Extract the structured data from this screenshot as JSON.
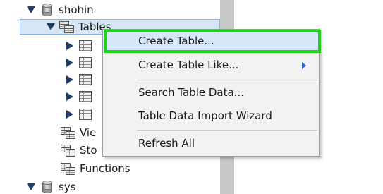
{
  "tree": {
    "schemas": [
      {
        "name": "shohin",
        "expanded": true
      },
      {
        "name": "sys",
        "expanded": true
      }
    ],
    "tables_label": "Tables",
    "views_label": "Vie",
    "stored_label": "Sto",
    "functions_label": "Functions"
  },
  "context_menu": {
    "items": [
      {
        "label": "Create Table...",
        "highlighted": true
      },
      {
        "label": "Create Table Like...",
        "submenu": true
      },
      {
        "label": "Search Table Data..."
      },
      {
        "label": "Table Data Import Wizard"
      },
      {
        "label": "Refresh All"
      }
    ]
  },
  "colors": {
    "highlight_focus": "#22d11f",
    "tree_selection": "#d7e6f7",
    "submenu_arrow": "#2a6bd0"
  },
  "icons": [
    "database-icon",
    "table-group-icon",
    "table-icon",
    "expand-arrow-icon",
    "collapse-arrow-icon",
    "submenu-arrow-icon"
  ]
}
